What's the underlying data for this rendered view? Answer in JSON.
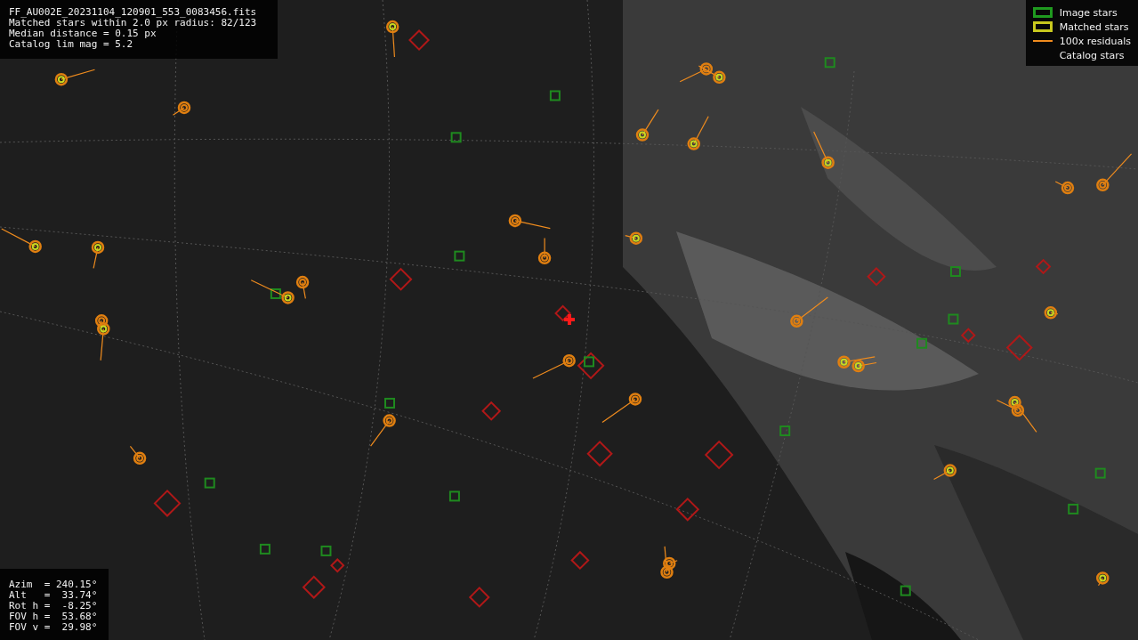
{
  "header": {
    "lines": [
      "FF_AU002E_20231104_120901_553_0083456.fits",
      "Matched stars within 2.0 px radius: 82/123",
      "Median distance = 0.15 px",
      "Catalog lim mag = 5.2"
    ]
  },
  "legend": {
    "items": [
      {
        "label": "Image stars",
        "kind": "box",
        "color": "#1f9a1f"
      },
      {
        "label": "Matched stars",
        "kind": "box",
        "color": "#c8c81e"
      },
      {
        "label": "100x residuals",
        "kind": "line",
        "color": "#f08c1e"
      },
      {
        "label": "Catalog stars",
        "kind": "none"
      }
    ]
  },
  "info": {
    "lines": [
      "Azim  = 240.15°",
      "Alt   =  33.74°",
      "Rot h =  -8.25°",
      "FOV h =  53.68°",
      "FOV v =  29.98°"
    ]
  }
}
